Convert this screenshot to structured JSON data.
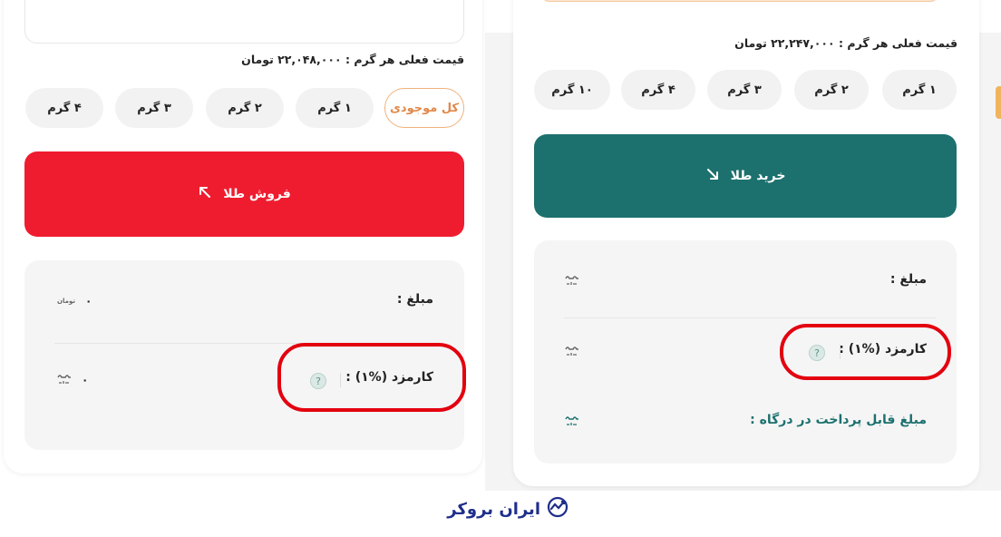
{
  "left": {
    "price_line": "قیمت فعلی هر گرم : ۲۲,۰۴۸,۰۰۰ تومان",
    "chips": [
      "کل موجودی",
      "۱ گرم",
      "۲ گرم",
      "۳ گرم",
      "۴ گرم"
    ],
    "active_chip": "کل موجودی",
    "sell_label": "فروش طلا",
    "amount_label": "مبلغ :",
    "amount_value": "۰",
    "fee_label": "کارمزد (%۱) :",
    "fee_value": "۰",
    "help_icon": "?",
    "currency_symbol": "تومان"
  },
  "right": {
    "price_line": "قیمت فعلی هر گرم : ۲۲,۲۴۷,۰۰۰ تومان",
    "chips": [
      "۱ گرم",
      "۲ گرم",
      "۳ گرم",
      "۴ گرم",
      "۱۰ گرم"
    ],
    "buy_label": "خرید طلا",
    "amount_label": "مبلغ :",
    "fee_label": "کارمزد (%۱) :",
    "payable_label": "مبلغ قابل پرداخت در درگاه :",
    "help_icon": "?"
  },
  "logo": {
    "text": "ایران بروکر"
  },
  "colors": {
    "sell": "#ef1c2f",
    "buy": "#1c716e",
    "highlight": "#e3000f",
    "active_chip": "#e0894a"
  },
  "icons": {
    "sell_arrow": "arrow-up-left-icon",
    "buy_arrow": "arrow-down-right-icon",
    "help": "question-circle-icon",
    "currency": "toman-icon",
    "logo": "chart-logo-icon"
  }
}
